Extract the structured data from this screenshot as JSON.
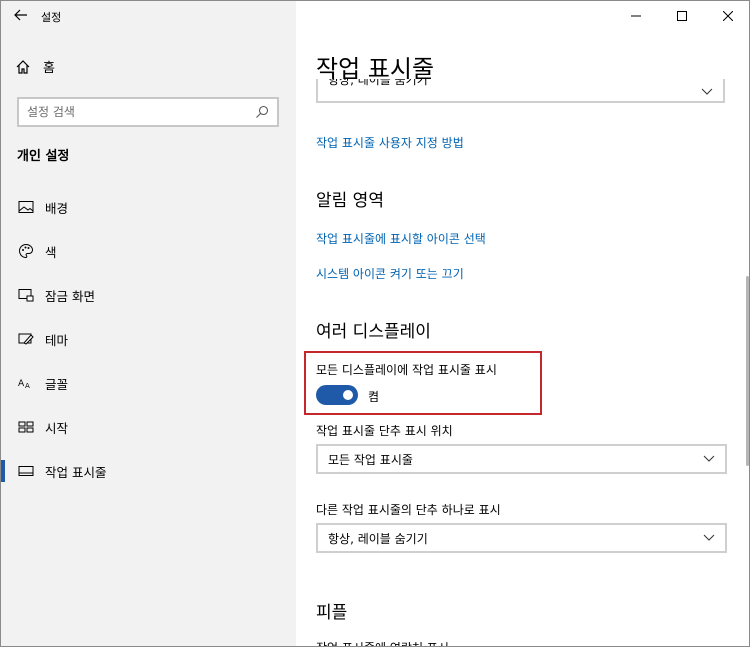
{
  "app": {
    "title": "설정"
  },
  "sidebar": {
    "home_label": "홈",
    "search_placeholder": "설정 검색",
    "section_title": "개인 설정",
    "items": [
      {
        "label": "배경",
        "icon": "picture-icon"
      },
      {
        "label": "색",
        "icon": "palette-icon"
      },
      {
        "label": "잠금 화면",
        "icon": "lock-screen-icon"
      },
      {
        "label": "테마",
        "icon": "theme-icon"
      },
      {
        "label": "글꼴",
        "icon": "font-icon"
      },
      {
        "label": "시작",
        "icon": "start-icon"
      },
      {
        "label": "작업 표시줄",
        "icon": "taskbar-icon",
        "active": true
      }
    ]
  },
  "main": {
    "title": "작업 표시줄",
    "partial_select_value": "항상, 레이블 숨기기",
    "customize_link": "작업 표시줄 사용자 지정 방법",
    "notification_area": {
      "heading": "알림 영역",
      "link1": "작업 표시줄에 표시할 아이콘 선택",
      "link2": "시스템 아이콘 켜기 또는 끄기"
    },
    "multiple_displays": {
      "heading": "여러 디스플레이",
      "show_all_label": "모든 디스플레이에 작업 표시줄 표시",
      "toggle_state": "켬",
      "toggle_on": true,
      "buttons_location_label": "작업 표시줄 단추 표시 위치",
      "buttons_location_value": "모든 작업 표시줄",
      "other_buttons_label": "다른 작업 표시줄의 단추 하나로 표시",
      "other_buttons_value": "항상, 레이블 숨기기"
    },
    "people": {
      "heading": "피플",
      "cut_text": "작업 표시줄에 연락처 표시"
    }
  },
  "colors": {
    "accent": "#1e5aa8",
    "link": "#0063b1",
    "highlight_border": "#c4282d",
    "sidebar_bg": "#f2f2f2"
  }
}
